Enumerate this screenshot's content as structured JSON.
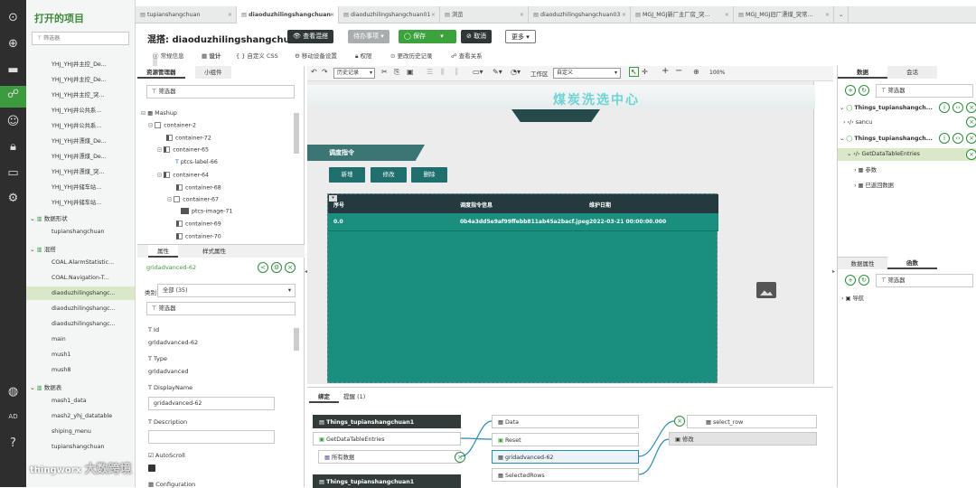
{
  "project_panel": {
    "title": "打开的项目",
    "filter_placeholder": "筛选器",
    "items_top": [
      "YHJ_YHJ井主控_De...",
      "YHJ_YHJ井主控_De...",
      "YHJ_YHJ井主控_突...",
      "YHJ_YHJ井公共系...",
      "YHJ_YHJ井公共系...",
      "YHJ_YHJ井漂煤_De...",
      "YHJ_YHJ井漂煤_De...",
      "YHJ_YHJ井漂煤_突...",
      "YHJ_YHJ井储车站...",
      "YHJ_YHJ井储车站..."
    ],
    "group_datashape": "数据形状",
    "datashape_items": [
      "tupianshangchuan"
    ],
    "group_mashup": "混搭",
    "mashup_items": [
      "COAL.AlarmStatistic...",
      "COAL.Navigation-T...",
      "diaoduzhilingshangc...",
      "diaoduzhilingshangc...",
      "diaoduzhilingshangc...",
      "main",
      "mush1",
      "mush8"
    ],
    "group_datatable": "数据表",
    "datatable_items": [
      "mash1_data",
      "mash2_yhj_datatable",
      "shiping_menu",
      "tupianshangchuan"
    ],
    "logo": "thingworx",
    "watermark": "大数跨境"
  },
  "tabs": [
    {
      "label": "tupianshangchuan",
      "active": false
    },
    {
      "label": "diaoduzhilingshangchuan",
      "active": true
    },
    {
      "label": "diaoduzhilingshangchuan01",
      "active": false
    },
    {
      "label": "浏览",
      "active": false
    },
    {
      "label": "diaoduzhilingshangchuan03",
      "active": false
    },
    {
      "label": "MGJ_MGJ新厂主厂房_突...",
      "active": false
    },
    {
      "label": "MGJ_MGJ旧厂漂煤_突常...",
      "active": false
    }
  ],
  "header": {
    "title": "混搭: diaoduzhilingshangchuan",
    "view_mashup": "查看混搭",
    "todo": "待办事项",
    "save": "保存",
    "cancel": "取消",
    "more": "更多"
  },
  "subtabs": [
    "常规信息",
    "设计",
    "自定义 CSS",
    "移动设备设置",
    "权限",
    "更改历史记录",
    "查看关系"
  ],
  "explorer": {
    "tab1": "资源管理器",
    "tab2": "小组件",
    "filter_placeholder": "筛选器",
    "tree": [
      "Mashup",
      "container-2",
      "container-72",
      "container-65",
      "ptcs-label-66",
      "container-64",
      "container-68",
      "container-67",
      "ptcs-image-71",
      "container-69",
      "container-70"
    ]
  },
  "props": {
    "tab1": "属性",
    "tab2": "样式属性",
    "widget_name": "gridadvanced-62",
    "category_label": "类别",
    "category_value": "全部 (35)",
    "filter_placeholder": "筛选器",
    "id_label": "Id",
    "id_value": "gridadvanced-62",
    "type_label": "Type",
    "type_value": "gridadvanced",
    "display_label": "DisplayName",
    "display_value": "gridadvanced-62",
    "desc_label": "Description",
    "autoscroll_label": "AutoScroll",
    "config_label": "Configuration"
  },
  "toolbar": {
    "history": "历史记录",
    "workspace_label": "工作区",
    "workspace_value": "自定义",
    "zoom": "100%"
  },
  "canvas": {
    "banner_title": "煤炭洗选中心",
    "section_title": "调度指令",
    "btn_add": "新增",
    "btn_edit": "修改",
    "btn_delete": "删除",
    "grid_headers": [
      "序号",
      "调度指令信息",
      "维护日期"
    ],
    "grid_row": [
      "0.0",
      "0b4a3dd5e9af99ffebb811ab45a2bacf.jpeg",
      "2022-03-21 00:00:00.000"
    ]
  },
  "binding": {
    "tab1": "绑定",
    "tab2": "提醒 (1)",
    "thing1": "Things_tupianshangchuan1",
    "service": "GetDataTableEntries",
    "alldata": "所有数据",
    "thing2": "Things_tupianshangchuan1",
    "data": "Data",
    "reset": "Reset",
    "grid": "gridadvanced-62",
    "selectedrows": "SelectedRows",
    "select_row": "select_row",
    "modify": "修改"
  },
  "right_panel": {
    "tab1": "数据",
    "tab2": "会话",
    "filter_placeholder": "筛选器",
    "thing1": "Things_tupianshangch...",
    "sancu": "sancu",
    "thing2": "Things_tupianshangch...",
    "entries": "GetDataTableEntries",
    "params": "参数",
    "returned": "已返回数据",
    "tab3": "数据属性",
    "tab4": "函数",
    "nav": "导航"
  }
}
